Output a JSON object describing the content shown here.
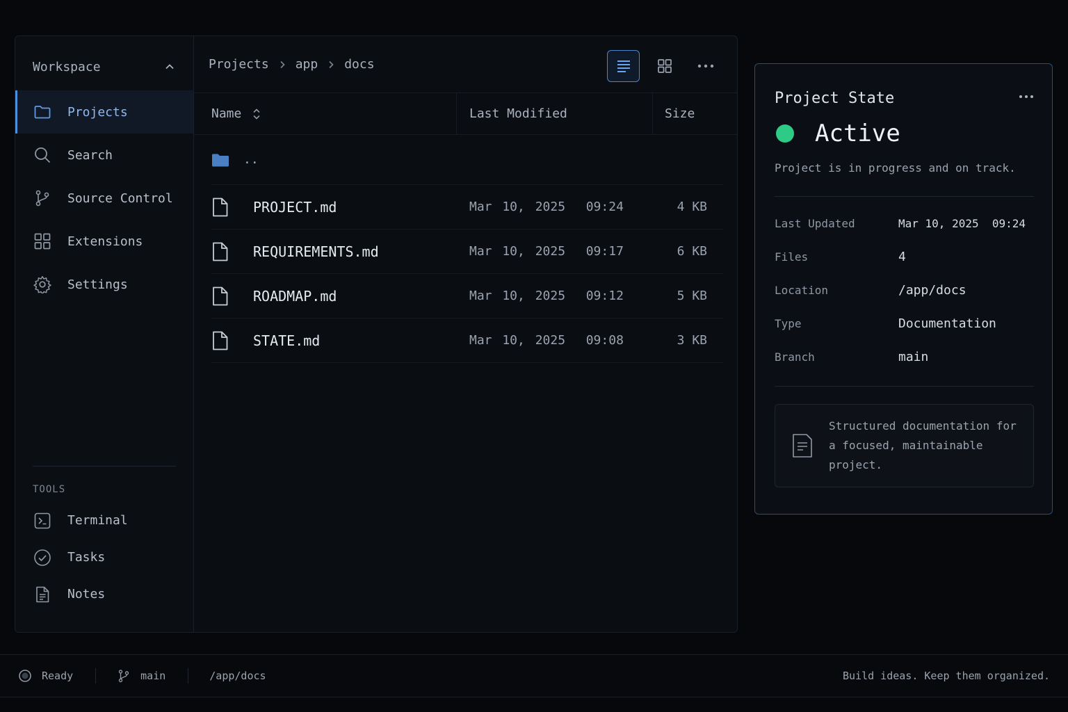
{
  "sidebar": {
    "workspace_title": "Workspace",
    "nav": [
      {
        "label": "Projects",
        "icon": "folder-icon",
        "active": true
      },
      {
        "label": "Search",
        "icon": "search-icon"
      },
      {
        "label": "Source Control",
        "icon": "git-branch-icon"
      },
      {
        "label": "Extensions",
        "icon": "grid-icon"
      },
      {
        "label": "Settings",
        "icon": "gear-icon"
      }
    ],
    "tools_label": "TOOLS",
    "tools": [
      {
        "label": "Terminal",
        "icon": "terminal-icon"
      },
      {
        "label": "Tasks",
        "icon": "check-circle-icon"
      },
      {
        "label": "Notes",
        "icon": "document-icon"
      }
    ]
  },
  "breadcrumb": [
    "Projects",
    "app",
    "docs"
  ],
  "table": {
    "headers": {
      "name": "Name",
      "modified": "Last Modified",
      "size": "Size"
    },
    "parent_label": "..",
    "rows": [
      {
        "name": "PROJECT.md",
        "modified": "Mar 10, 2025  09:24",
        "size": "4 KB"
      },
      {
        "name": "REQUIREMENTS.md",
        "modified": "Mar 10, 2025  09:17",
        "size": "6 KB"
      },
      {
        "name": "ROADMAP.md",
        "modified": "Mar 10, 2025  09:12",
        "size": "5 KB"
      },
      {
        "name": "STATE.md",
        "modified": "Mar 10, 2025  09:08",
        "size": "3 KB"
      }
    ]
  },
  "panel": {
    "title": "Project State",
    "status": "Active",
    "status_color": "#2ecb87",
    "description": "Project is in progress and on track.",
    "props": [
      {
        "key": "Last Updated",
        "value": "Mar 10, 2025  09:24"
      },
      {
        "key": "Files",
        "value": "4"
      },
      {
        "key": "Location",
        "value": "/app/docs"
      },
      {
        "key": "Type",
        "value": "Documentation"
      },
      {
        "key": "Branch",
        "value": "main"
      }
    ],
    "note": "Structured documentation for a focused, maintainable project."
  },
  "statusbar": {
    "state": "Ready",
    "branch": "main",
    "path": "/app/docs",
    "tagline": "Build ideas. Keep them organized."
  },
  "colors": {
    "accent": "#4b8fe2",
    "panel_border": "#2b4e77",
    "success": "#2ecb87"
  }
}
